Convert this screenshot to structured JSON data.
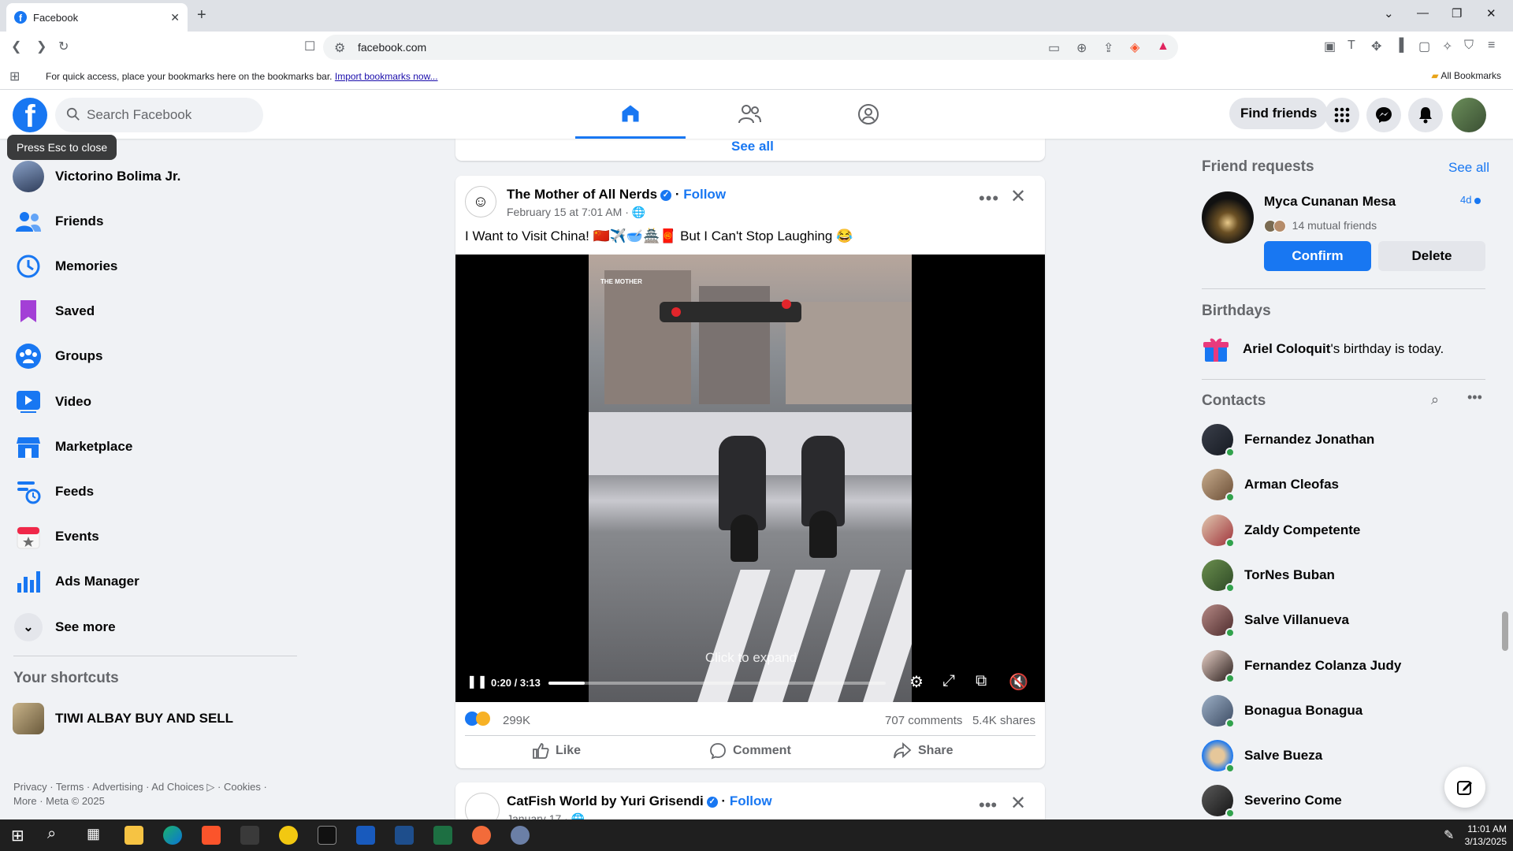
{
  "browser": {
    "tab_title": "Facebook",
    "url": "facebook.com",
    "bookmarks_msg": "For quick access, place your bookmarks here on the bookmarks bar.",
    "import_link": "Import bookmarks now...",
    "all_bookmarks": "All Bookmarks"
  },
  "header": {
    "search_placeholder": "Search Facebook",
    "find_friends": "Find friends",
    "tooltip": "Press Esc to close"
  },
  "leftnav": {
    "profile_name": "Victorino Bolima Jr.",
    "items": [
      {
        "label": "Friends",
        "icon": "friends-icon"
      },
      {
        "label": "Memories",
        "icon": "clock-icon"
      },
      {
        "label": "Saved",
        "icon": "bookmark-icon"
      },
      {
        "label": "Groups",
        "icon": "groups-icon"
      },
      {
        "label": "Video",
        "icon": "video-icon"
      },
      {
        "label": "Marketplace",
        "icon": "shop-icon"
      },
      {
        "label": "Feeds",
        "icon": "feeds-icon"
      },
      {
        "label": "Events",
        "icon": "calendar-icon"
      },
      {
        "label": "Ads Manager",
        "icon": "bar-chart-icon"
      }
    ],
    "see_more": "See more",
    "shortcuts_title": "Your shortcuts",
    "shortcut": "TIWI ALBAY BUY AND SELL",
    "footer_line1": "Privacy · Terms · Advertising · Ad Choices ▷ · Cookies ·",
    "footer_line2": "More · Meta © 2025"
  },
  "feed": {
    "prev_card_see_all": "See all",
    "post": {
      "author": "The Mother of All Nerds",
      "follow": "Follow",
      "date": "February 15 at 7:01 AM · ",
      "text": "I Want to Visit China! 🇨🇳✈️🥣🏯🧧 But I Can't Stop Laughing 😂",
      "video_time": "0:20 / 3:13",
      "video_progress": 0.107,
      "click_to_expand": "Click to expand",
      "reaction_count": "299K",
      "comments": "707 comments",
      "shares": "5.4K shares",
      "like": "Like",
      "comment": "Comment",
      "share": "Share"
    },
    "post2": {
      "author": "CatFish World by Yuri Grisendi",
      "follow": "Follow",
      "date": "January 17 · "
    }
  },
  "rightrail": {
    "friend_requests_title": "Friend requests",
    "see_all": "See all",
    "request": {
      "name": "Myca Cunanan Mesa",
      "time": "4d",
      "mutual": "14 mutual friends",
      "confirm": "Confirm",
      "delete": "Delete"
    },
    "birthdays_title": "Birthdays",
    "birthday_name": "Ariel Coloquit",
    "birthday_suffix": "'s birthday is today.",
    "contacts_title": "Contacts",
    "contacts": [
      "Fernandez Jonathan",
      "Arman Cleofas",
      "Zaldy Competente",
      "TorNes Buban",
      "Salve Villanueva",
      "Fernandez Colanza Judy",
      "Bonagua Bonagua",
      "Salve Bueza",
      "Severino Come"
    ]
  },
  "taskbar": {
    "time": "11:01 AM",
    "date": "3/13/2025"
  },
  "colors": {
    "brand": "#1877f2",
    "online": "#31a24c"
  }
}
